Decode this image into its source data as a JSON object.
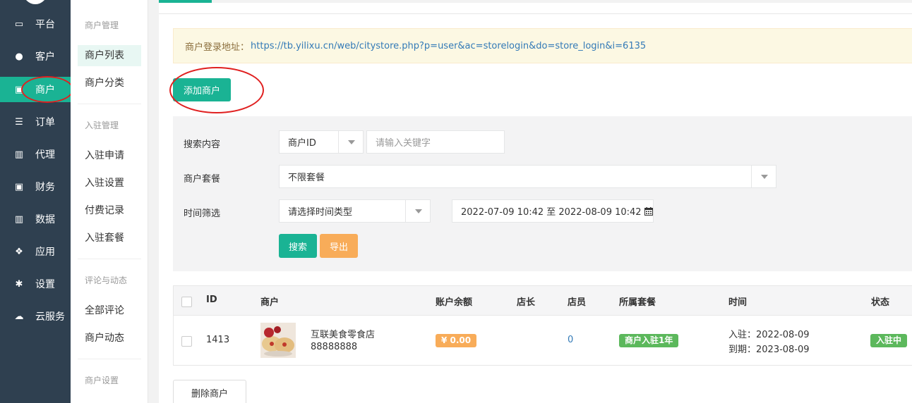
{
  "nav": {
    "items": [
      {
        "label": "平台",
        "icon": "monitor-icon",
        "glyph": "▭"
      },
      {
        "label": "客户",
        "icon": "user-icon",
        "glyph": "●"
      },
      {
        "label": "商户",
        "icon": "store-icon",
        "glyph": "▣"
      },
      {
        "label": "订单",
        "icon": "list-icon",
        "glyph": "☰"
      },
      {
        "label": "代理",
        "icon": "map-icon",
        "glyph": "▥"
      },
      {
        "label": "财务",
        "icon": "money-icon",
        "glyph": "▣"
      },
      {
        "label": "数据",
        "icon": "bar-chart-icon",
        "glyph": "▥"
      },
      {
        "label": "应用",
        "icon": "cubes-icon",
        "glyph": "❖"
      },
      {
        "label": "设置",
        "icon": "gear-icon",
        "glyph": "✱"
      },
      {
        "label": "云服务",
        "icon": "cloud-icon",
        "glyph": "☁"
      }
    ]
  },
  "subnav": {
    "g1": "商户管理",
    "merchant_list": "商户列表",
    "merchant_category": "商户分类",
    "g2": "入驻管理",
    "apply": "入驻申请",
    "settle_settings": "入驻设置",
    "fee_records": "付费记录",
    "packages": "入驻套餐",
    "g3": "评论与动态",
    "all_comments": "全部评论",
    "merchant_dynamics": "商户动态",
    "g4": "商户设置"
  },
  "notice": {
    "label": "商户登录地址：",
    "url": "https://tb.yilixu.cn/web/citystore.php?p=user&ac=storelogin&do=store_login&i=6135"
  },
  "add_button": "添加商户",
  "search": {
    "content_label": "搜索内容",
    "type_value": "商户ID",
    "keyword_placeholder": "请输入关键字",
    "package_label": "商户套餐",
    "package_value": "不限套餐",
    "time_label": "时间筛选",
    "time_type_value": "请选择时间类型",
    "date_range": "2022-07-09 10:42 至 2022-08-09 10:42",
    "search_button": "搜索",
    "export_button": "导出"
  },
  "table": {
    "headers": [
      "ID",
      "商户",
      "账户余额",
      "店长",
      "店员",
      "所属套餐",
      "时间",
      "状态"
    ],
    "rows": [
      {
        "id": "1413",
        "name": "互联美食零食店",
        "phone": "88888888",
        "balance": "¥ 0.00",
        "manager": "",
        "staff": "0",
        "package": "商户入驻1年",
        "joined": "入驻：2022-08-09",
        "expires": "到期：2023-08-09",
        "status": "入驻中"
      }
    ]
  },
  "delete_button": "删除商户",
  "colors": {
    "nav_bg": "#2f4050",
    "accent": "#1ab394",
    "orange": "#f8ac59",
    "annotation": "#e02020"
  }
}
